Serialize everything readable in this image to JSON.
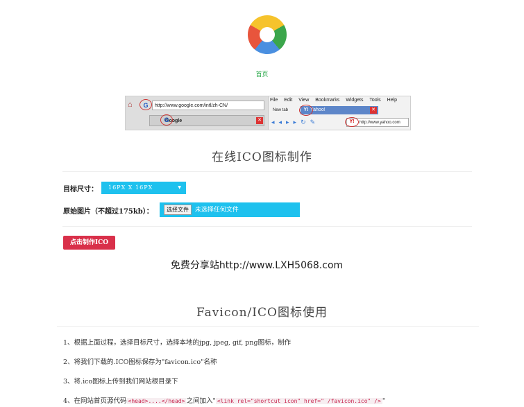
{
  "header": {
    "home_link": "首页"
  },
  "browsers_illustration": {
    "browser1": {
      "url": "http://www.google.com/intl/zh-CN/",
      "tab_title": "Google"
    },
    "browser2": {
      "menu": [
        "File",
        "Edit",
        "View",
        "Bookmarks",
        "Widgets",
        "Tools",
        "Help"
      ],
      "tab_new": "New tab",
      "tab_active": "Yahoo!",
      "url": "http://www.yahoo.com"
    }
  },
  "tool": {
    "title": "在线ICO图标制作",
    "size_label": "目标尺寸：",
    "size_value": "16PX  X  16PX",
    "image_label": "原始图片（不超过175kb）：",
    "choose_file_button": "选择文件",
    "no_file_text": "未选择任何文件",
    "make_button": "点击制作ICO"
  },
  "watermark": "免费分享站http://www.LXH5068.com",
  "usage": {
    "title": "Favicon/ICO图标使用",
    "step1": "1、根据上面过程，选择目标尺寸，选择本地的jpg, jpeg, gif, png图标，制作",
    "step2": "2、将我们下载的.ICO图标保存为\"favicon.ico\"名称",
    "step3": "3、将.ico图标上传到我们网站根目录下",
    "step4_prefix": "4、在网站首页源代码",
    "step4_code1": "<head>....</head>",
    "step4_mid": "之间加入\"",
    "step4_code2": "<link rel=\"shortcut icon\" href=\" /favicon.ico\" />",
    "step4_suffix": "\""
  },
  "colors": {
    "accent_cyan": "#1ec1ee",
    "make_button_red": "#d9304a",
    "home_link_green": "#2aa84a"
  }
}
